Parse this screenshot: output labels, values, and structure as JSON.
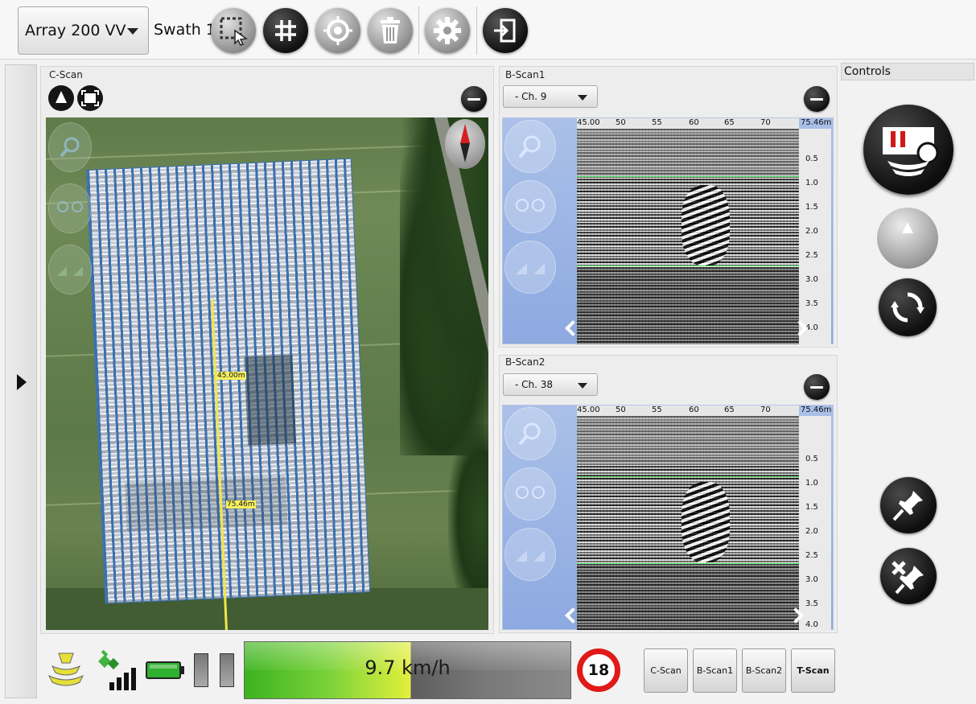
{
  "toolbar": {
    "array_select": "Array 200 VV",
    "swath_label": "Swath 1",
    "buttons": [
      "select-area",
      "grid",
      "target",
      "delete",
      "settings",
      "exit"
    ]
  },
  "cscan": {
    "title": "C-Scan",
    "label_top": "45.00m",
    "label_bottom": "75.46m"
  },
  "bscan1": {
    "title": "B-Scan1",
    "channel": "- Ch. 9",
    "x_ticks": [
      "45.00",
      "50",
      "55",
      "60",
      "65",
      "70",
      "75.46m"
    ],
    "y_ticks": [
      "0.5",
      "1.0",
      "1.5",
      "2.0",
      "2.5",
      "3.0",
      "3.5",
      "4.0"
    ]
  },
  "bscan2": {
    "title": "B-Scan2",
    "channel": "- Ch. 38",
    "x_ticks": [
      "45.00",
      "50",
      "55",
      "60",
      "65",
      "70",
      "75.46m"
    ],
    "y_ticks": [
      "0.5",
      "1.0",
      "1.5",
      "2.0",
      "2.5",
      "3.0",
      "3.5",
      "4.0"
    ]
  },
  "controls": {
    "title": "Controls"
  },
  "status": {
    "speed": "9.7 km/h",
    "speed_fraction": 0.51,
    "speed_limit": "18"
  },
  "view_buttons": {
    "cscan": "C-Scan",
    "bscan1": "B-Scan1",
    "bscan2": "B-Scan2",
    "tscan": "T-Scan"
  },
  "colors": {
    "accent_red": "#e01919",
    "grid_green": "#53e063",
    "track_blue": "#3a6fb0"
  }
}
